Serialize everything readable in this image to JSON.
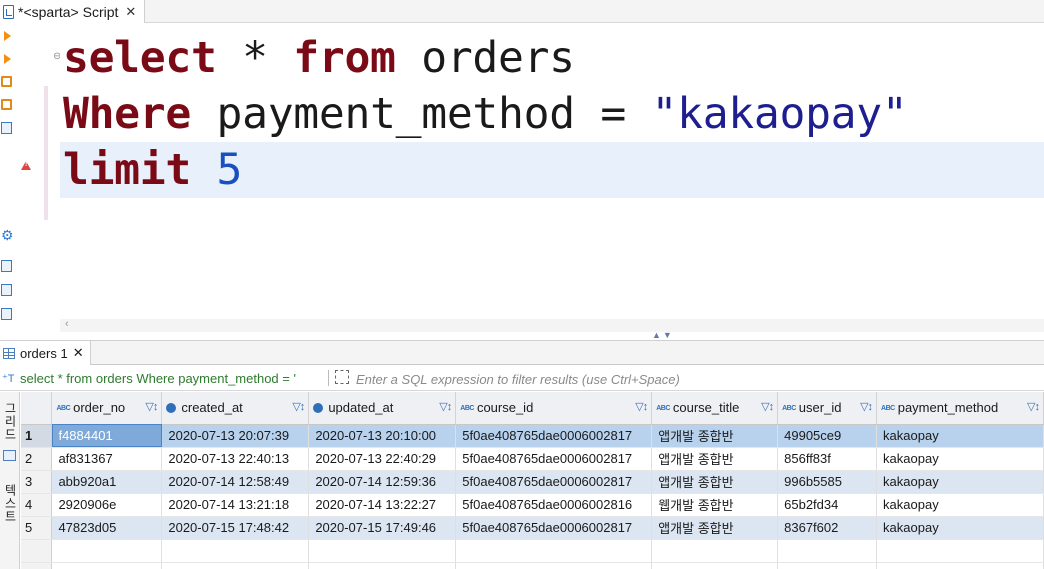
{
  "editor_tab": {
    "title": "*<sparta> Script",
    "close": "✕"
  },
  "code": {
    "line1": {
      "kw1": "select",
      "mid": " * ",
      "kw2": "from",
      "rest": " orders"
    },
    "line2": {
      "kw": "Where",
      "mid": " payment_method = ",
      "str": "\"kakaopay\""
    },
    "line3": {
      "kw": "limit",
      "mid": " ",
      "num": "5"
    }
  },
  "results_tab": {
    "title": "orders 1",
    "close": "✕"
  },
  "filter": {
    "query_text": "select * from orders Where payment_method = '",
    "placeholder": "Enter a SQL expression to filter results (use Ctrl+Space)"
  },
  "side_labels": {
    "top": "그리드",
    "bottom": "텍스트"
  },
  "columns": [
    {
      "name": "order_no",
      "type_icon": "abc-key-icon"
    },
    {
      "name": "created_at",
      "type_icon": "clock-icon"
    },
    {
      "name": "updated_at",
      "type_icon": "clock-icon"
    },
    {
      "name": "course_id",
      "type_icon": "abc-icon"
    },
    {
      "name": "course_title",
      "type_icon": "abc-icon"
    },
    {
      "name": "user_id",
      "type_icon": "abc-key-icon"
    },
    {
      "name": "payment_method",
      "type_icon": "abc-icon"
    }
  ],
  "rows": [
    {
      "n": "1",
      "cells": [
        "f4884401",
        "2020-07-13 20:07:39",
        "2020-07-13 20:10:00",
        "5f0ae408765dae0006002817",
        "앱개발 종합반",
        "49905ce9",
        "kakaopay"
      ]
    },
    {
      "n": "2",
      "cells": [
        "af831367",
        "2020-07-13 22:40:13",
        "2020-07-13 22:40:29",
        "5f0ae408765dae0006002817",
        "앱개발 종합반",
        "856ff83f",
        "kakaopay"
      ]
    },
    {
      "n": "3",
      "cells": [
        "abb920a1",
        "2020-07-14 12:58:49",
        "2020-07-14 12:59:36",
        "5f0ae408765dae0006002817",
        "앱개발 종합반",
        "996b5585",
        "kakaopay"
      ]
    },
    {
      "n": "4",
      "cells": [
        "2920906e",
        "2020-07-14 13:21:18",
        "2020-07-14 13:22:27",
        "5f0ae408765dae0006002816",
        "웹개발 종합반",
        "65b2fd34",
        "kakaopay"
      ]
    },
    {
      "n": "5",
      "cells": [
        "47823d05",
        "2020-07-15 17:48:42",
        "2020-07-15 17:49:46",
        "5f0ae408765dae0006002817",
        "앱개발 종합반",
        "8367f602",
        "kakaopay"
      ]
    }
  ],
  "colors": {
    "keyword": "#7a0a16",
    "string": "#1e1e8f",
    "number": "#1a4fc2",
    "selected_row": "#b8d2ee",
    "alt_row": "#dce6f2"
  }
}
